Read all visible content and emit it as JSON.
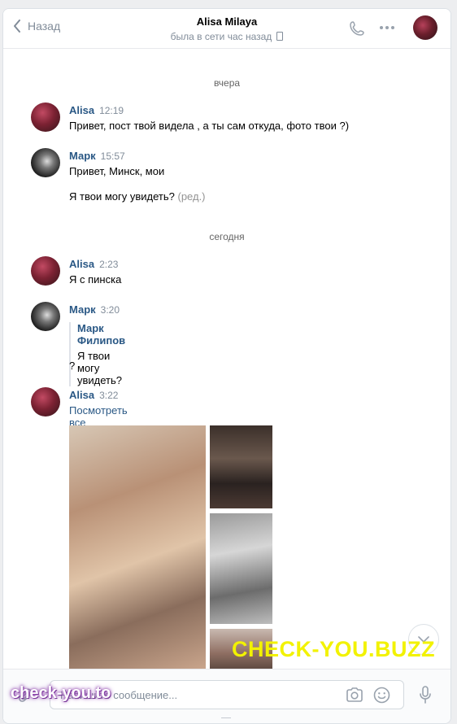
{
  "header": {
    "back_label": "Назад",
    "title": "Alisa Milaya",
    "status": "была в сети час назад",
    "icons": [
      "back-chevron-icon",
      "phone-icon",
      "more-icon"
    ]
  },
  "days": {
    "yesterday": "вчера",
    "today": "сегодня"
  },
  "messages": [
    {
      "author": "Alisa",
      "time": "12:19",
      "text": "Привет, пост твой видела , а ты сам откуда, фото твои ?)"
    },
    {
      "author": "Марк",
      "time": "15:57",
      "text": "Привет, Минск, мои",
      "text2": "Я твои могу увидеть?",
      "edited": "(ред.)"
    },
    {
      "author": "Alisa",
      "time": "2:23",
      "text": "Я с пинска"
    },
    {
      "author": "Марк",
      "time": "3:20",
      "quote_author": "Марк Филипов",
      "quote_text": "Я твои могу увидеть?",
      "text": "?"
    },
    {
      "author": "Alisa",
      "time": "3:22",
      "link": "Посмотреть все изображения"
    }
  ],
  "composer": {
    "placeholder": "Напишите сообщение..."
  },
  "watermarks": {
    "top": "CHECK-YOU.BUZZ",
    "bottom": "check-you.to"
  },
  "colors": {
    "link": "#2a5885",
    "muted": "#818c99",
    "background": "#edeef0"
  }
}
